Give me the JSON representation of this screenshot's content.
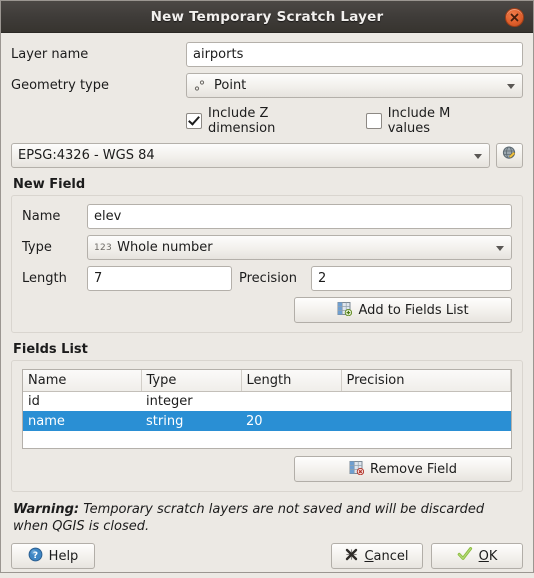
{
  "window": {
    "title": "New Temporary Scratch Layer",
    "close_icon": "close-icon"
  },
  "form": {
    "layer_name_label": "Layer name",
    "layer_name_value": "airports",
    "layer_name_placeholder": "",
    "geometry_type_label": "Geometry type",
    "geometry_type_value": "Point",
    "geometry_icon": "point-geometry-icon",
    "include_z_label": "Include Z dimension",
    "include_z_checked": true,
    "include_m_label": "Include M values",
    "include_m_checked": false,
    "crs_value": "EPSG:4326 - WGS 84",
    "crs_button_icon": "globe-crs-select-icon"
  },
  "new_field": {
    "group_title": "New Field",
    "name_label": "Name",
    "name_value": "elev",
    "type_label": "Type",
    "type_value": "Whole number",
    "type_icon_text": "123",
    "length_label": "Length",
    "length_value": "7",
    "precision_label": "Precision",
    "precision_value": "2",
    "add_button_label": "Add to Fields List",
    "add_button_icon": "table-add-icon"
  },
  "fields_list": {
    "group_title": "Fields List",
    "columns": [
      "Name",
      "Type",
      "Length",
      "Precision"
    ],
    "rows": [
      {
        "name": "id",
        "type": "integer",
        "length": "",
        "precision": "",
        "selected": false
      },
      {
        "name": "name",
        "type": "string",
        "length": "20",
        "precision": "",
        "selected": true
      }
    ],
    "remove_button_label": "Remove Field",
    "remove_button_icon": "table-remove-icon",
    "selection_color": "#2a8fd4"
  },
  "warning": {
    "prefix": "Warning:",
    "text": "Temporary scratch layers are not saved and will be discarded when QGIS is closed."
  },
  "footer": {
    "help_label": "Help",
    "help_icon": "help-question-icon",
    "cancel_label": "Cancel",
    "cancel_icon": "cancel-x-icon",
    "ok_label": "OK",
    "ok_icon": "check-icon"
  }
}
